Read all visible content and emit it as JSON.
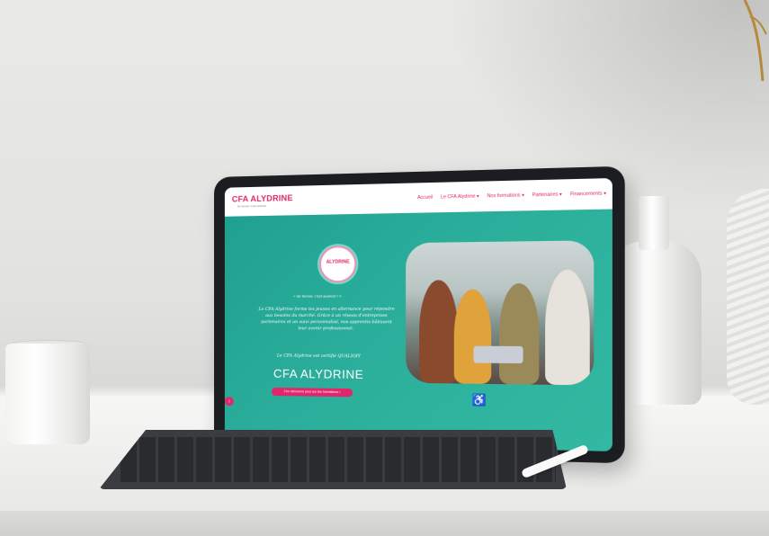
{
  "site": {
    "logo": "CFA ALYDRINE",
    "logo_sub": "Se former, c'est avancer",
    "nav": [
      "Accueil",
      "Le CFA Alydrine ▾",
      "Nos formations ▾",
      "Partenaires ▾",
      "Financements ▾"
    ],
    "badge": "ALYDRINE",
    "tagline": "« Se former, c'est avancer ! »",
    "description": "Le CFA Alydrine forme les jeunes en alternance pour répondre aux besoins du marché. Grâce à un réseau d'entreprises partenaires et un suivi personnalisé, nos apprentis bâtissent leur avenir professionnel.",
    "certification": "Le CFA Alydrine est certifié QUALIOPI",
    "brand": "CFA ALYDRINE",
    "cta": "J'en découvre plus sur les formations !",
    "accessibility_icon": "wheelchair-icon",
    "scroll_icon": "arrow-down-icon"
  },
  "colors": {
    "accent": "#e0276b",
    "teal": "#2aae9b"
  }
}
